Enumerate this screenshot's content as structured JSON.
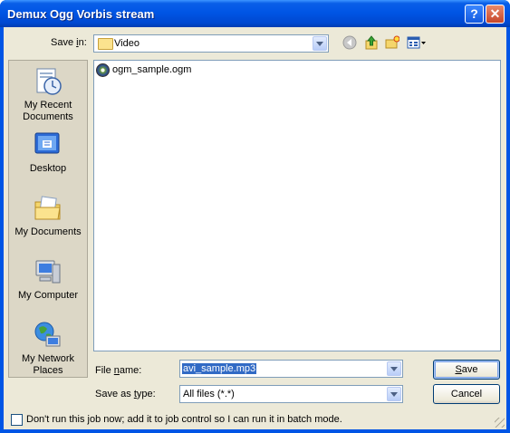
{
  "window": {
    "title": "Demux Ogg Vorbis stream"
  },
  "title_buttons": {
    "help": "?",
    "close": "✕"
  },
  "toolbar": {
    "save_in_prefix": "Save ",
    "save_in_key": "i",
    "save_in_suffix": "n:",
    "location": "Video"
  },
  "places": [
    {
      "line1": "My Recent",
      "line2": "Documents",
      "icon": "recent-documents-icon"
    },
    {
      "line1": "Desktop",
      "line2": "",
      "icon": "desktop-icon"
    },
    {
      "line1": "My Documents",
      "line2": "",
      "icon": "my-documents-icon"
    },
    {
      "line1": "My Computer",
      "line2": "",
      "icon": "my-computer-icon"
    },
    {
      "line1": "My Network",
      "line2": "Places",
      "icon": "network-places-icon"
    }
  ],
  "files": [
    {
      "name": "ogm_sample.ogm"
    }
  ],
  "filename": {
    "label_prefix": "File ",
    "label_key": "n",
    "label_suffix": "ame:",
    "value": "avi_sample.mp3"
  },
  "filetype": {
    "label_prefix": "Save as ",
    "label_key": "t",
    "label_suffix": "ype:",
    "value": "All files (*.*)"
  },
  "buttons": {
    "save_key": "S",
    "save_rest": "ave",
    "cancel": "Cancel"
  },
  "checkbox": {
    "label": "Don't run this job now; add it to job control so I can run it in batch mode.",
    "checked": false
  },
  "colors": {
    "titlebar": "#0055e5",
    "dialog_bg": "#ece9d8",
    "selection": "#316ac5"
  }
}
